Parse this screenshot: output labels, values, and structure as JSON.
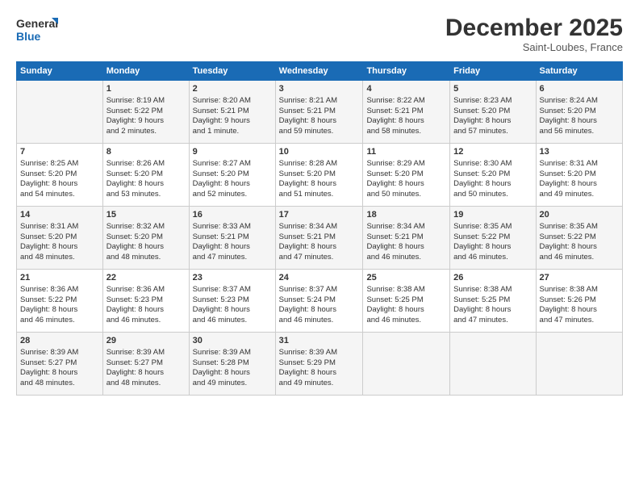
{
  "logo": {
    "line1": "General",
    "line2": "Blue"
  },
  "title": "December 2025",
  "location": "Saint-Loubes, France",
  "days_header": [
    "Sunday",
    "Monday",
    "Tuesday",
    "Wednesday",
    "Thursday",
    "Friday",
    "Saturday"
  ],
  "weeks": [
    [
      {
        "day": "",
        "content": ""
      },
      {
        "day": "1",
        "content": "Sunrise: 8:19 AM\nSunset: 5:22 PM\nDaylight: 9 hours\nand 2 minutes."
      },
      {
        "day": "2",
        "content": "Sunrise: 8:20 AM\nSunset: 5:21 PM\nDaylight: 9 hours\nand 1 minute."
      },
      {
        "day": "3",
        "content": "Sunrise: 8:21 AM\nSunset: 5:21 PM\nDaylight: 8 hours\nand 59 minutes."
      },
      {
        "day": "4",
        "content": "Sunrise: 8:22 AM\nSunset: 5:21 PM\nDaylight: 8 hours\nand 58 minutes."
      },
      {
        "day": "5",
        "content": "Sunrise: 8:23 AM\nSunset: 5:20 PM\nDaylight: 8 hours\nand 57 minutes."
      },
      {
        "day": "6",
        "content": "Sunrise: 8:24 AM\nSunset: 5:20 PM\nDaylight: 8 hours\nand 56 minutes."
      }
    ],
    [
      {
        "day": "7",
        "content": "Sunrise: 8:25 AM\nSunset: 5:20 PM\nDaylight: 8 hours\nand 54 minutes."
      },
      {
        "day": "8",
        "content": "Sunrise: 8:26 AM\nSunset: 5:20 PM\nDaylight: 8 hours\nand 53 minutes."
      },
      {
        "day": "9",
        "content": "Sunrise: 8:27 AM\nSunset: 5:20 PM\nDaylight: 8 hours\nand 52 minutes."
      },
      {
        "day": "10",
        "content": "Sunrise: 8:28 AM\nSunset: 5:20 PM\nDaylight: 8 hours\nand 51 minutes."
      },
      {
        "day": "11",
        "content": "Sunrise: 8:29 AM\nSunset: 5:20 PM\nDaylight: 8 hours\nand 50 minutes."
      },
      {
        "day": "12",
        "content": "Sunrise: 8:30 AM\nSunset: 5:20 PM\nDaylight: 8 hours\nand 50 minutes."
      },
      {
        "day": "13",
        "content": "Sunrise: 8:31 AM\nSunset: 5:20 PM\nDaylight: 8 hours\nand 49 minutes."
      }
    ],
    [
      {
        "day": "14",
        "content": "Sunrise: 8:31 AM\nSunset: 5:20 PM\nDaylight: 8 hours\nand 48 minutes."
      },
      {
        "day": "15",
        "content": "Sunrise: 8:32 AM\nSunset: 5:20 PM\nDaylight: 8 hours\nand 48 minutes."
      },
      {
        "day": "16",
        "content": "Sunrise: 8:33 AM\nSunset: 5:21 PM\nDaylight: 8 hours\nand 47 minutes."
      },
      {
        "day": "17",
        "content": "Sunrise: 8:34 AM\nSunset: 5:21 PM\nDaylight: 8 hours\nand 47 minutes."
      },
      {
        "day": "18",
        "content": "Sunrise: 8:34 AM\nSunset: 5:21 PM\nDaylight: 8 hours\nand 46 minutes."
      },
      {
        "day": "19",
        "content": "Sunrise: 8:35 AM\nSunset: 5:22 PM\nDaylight: 8 hours\nand 46 minutes."
      },
      {
        "day": "20",
        "content": "Sunrise: 8:35 AM\nSunset: 5:22 PM\nDaylight: 8 hours\nand 46 minutes."
      }
    ],
    [
      {
        "day": "21",
        "content": "Sunrise: 8:36 AM\nSunset: 5:22 PM\nDaylight: 8 hours\nand 46 minutes."
      },
      {
        "day": "22",
        "content": "Sunrise: 8:36 AM\nSunset: 5:23 PM\nDaylight: 8 hours\nand 46 minutes."
      },
      {
        "day": "23",
        "content": "Sunrise: 8:37 AM\nSunset: 5:23 PM\nDaylight: 8 hours\nand 46 minutes."
      },
      {
        "day": "24",
        "content": "Sunrise: 8:37 AM\nSunset: 5:24 PM\nDaylight: 8 hours\nand 46 minutes."
      },
      {
        "day": "25",
        "content": "Sunrise: 8:38 AM\nSunset: 5:25 PM\nDaylight: 8 hours\nand 46 minutes."
      },
      {
        "day": "26",
        "content": "Sunrise: 8:38 AM\nSunset: 5:25 PM\nDaylight: 8 hours\nand 47 minutes."
      },
      {
        "day": "27",
        "content": "Sunrise: 8:38 AM\nSunset: 5:26 PM\nDaylight: 8 hours\nand 47 minutes."
      }
    ],
    [
      {
        "day": "28",
        "content": "Sunrise: 8:39 AM\nSunset: 5:27 PM\nDaylight: 8 hours\nand 48 minutes."
      },
      {
        "day": "29",
        "content": "Sunrise: 8:39 AM\nSunset: 5:27 PM\nDaylight: 8 hours\nand 48 minutes."
      },
      {
        "day": "30",
        "content": "Sunrise: 8:39 AM\nSunset: 5:28 PM\nDaylight: 8 hours\nand 49 minutes."
      },
      {
        "day": "31",
        "content": "Sunrise: 8:39 AM\nSunset: 5:29 PM\nDaylight: 8 hours\nand 49 minutes."
      },
      {
        "day": "",
        "content": ""
      },
      {
        "day": "",
        "content": ""
      },
      {
        "day": "",
        "content": ""
      }
    ]
  ]
}
